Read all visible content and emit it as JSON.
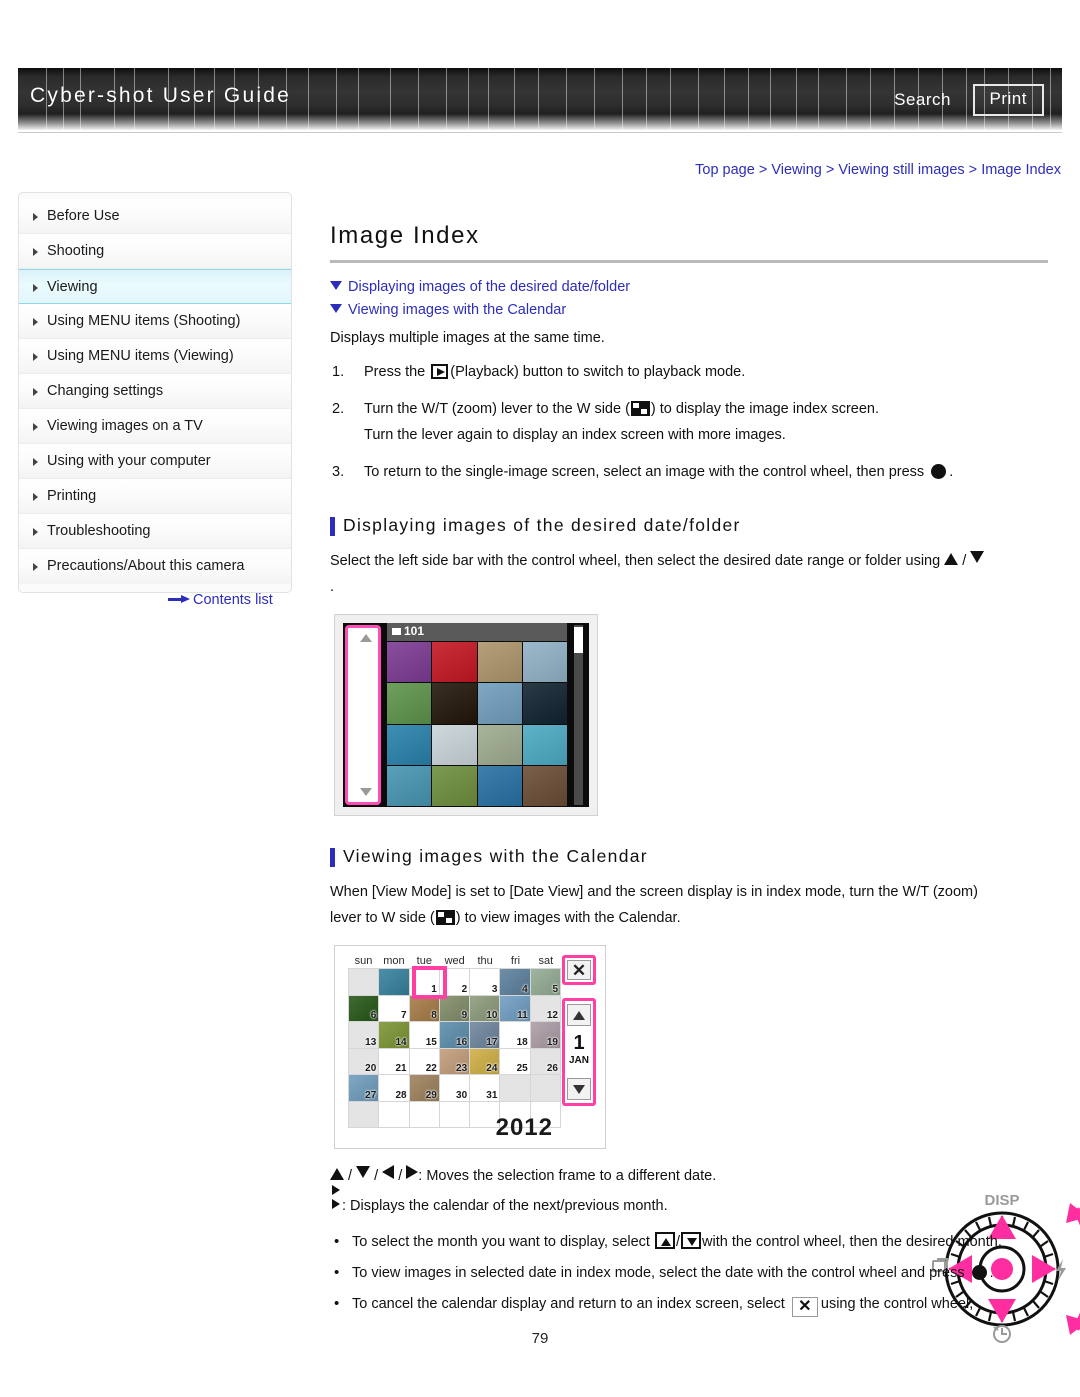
{
  "header": {
    "title": "Cyber-shot User Guide",
    "search_label": "Search",
    "print_label": "Print"
  },
  "breadcrumb": {
    "items": [
      "Top page",
      "Viewing",
      "Viewing still images",
      "Image Index"
    ],
    "separator": ">"
  },
  "sidebar": {
    "items": [
      {
        "label": "Before Use",
        "active": false
      },
      {
        "label": "Shooting",
        "active": false
      },
      {
        "label": "Viewing",
        "active": true
      },
      {
        "label": "Using MENU items (Shooting)",
        "active": false
      },
      {
        "label": "Using MENU items (Viewing)",
        "active": false
      },
      {
        "label": "Changing settings",
        "active": false
      },
      {
        "label": "Viewing images on a TV",
        "active": false
      },
      {
        "label": "Using with your computer",
        "active": false
      },
      {
        "label": "Printing",
        "active": false
      },
      {
        "label": "Troubleshooting",
        "active": false
      },
      {
        "label": "Precautions/About this camera",
        "active": false
      }
    ],
    "contents_link": "Contents list"
  },
  "main": {
    "page_title": "Image Index",
    "anchors": [
      "Displaying images of the desired date/folder",
      "Viewing images with the Calendar"
    ],
    "intro": "Displays multiple images at the same time.",
    "steps": [
      {
        "num": "1.",
        "before_icon": "Press the",
        "icon": "playback-icon",
        "after_icon": "(Playback) button to switch to playback mode."
      },
      {
        "num": "2.",
        "before_icon": "Turn the W/T (zoom) lever to the W side (",
        "icon": "index-icon",
        "after_icon": ") to display the image index screen.",
        "line2": "Turn the lever again to display an index screen with more images."
      },
      {
        "num": "3.",
        "before_icon": "To return to the single-image screen, select an image with the control wheel, then press",
        "icon": "center-button-icon",
        "after_icon": "."
      }
    ],
    "section1": {
      "heading": "Displaying images of the desired date/folder",
      "text_before": "Select the left side bar with the control wheel, then select the desired date range or folder using",
      "text_after": ".",
      "up_icon": "up-triangle-icon",
      "down_icon": "down-triangle-icon",
      "separator": "/"
    },
    "section2": {
      "heading": "Viewing images with the Calendar",
      "line1_before": "When [View Mode] is set to [Date View] and the screen display is in index mode, turn the W/T (zoom)",
      "line2_before": "lever to W side (",
      "line2_icon": "index-icon",
      "line2_after": ") to view images with the Calendar."
    },
    "legend": [
      {
        "icons": [
          "up-triangle-icon",
          "down-triangle-icon",
          "left-triangle-icon",
          "right-triangle-icon"
        ],
        "separator": "/",
        "text": ": Moves the selection frame to a different date."
      },
      {
        "text": ": Displays the calendar of the next/previous month."
      }
    ],
    "bullets": [
      {
        "before": "To select the month you want to display, select",
        "icon_up": "button-up-icon",
        "icon_sep": "/",
        "icon_down": "button-down-icon",
        "after": "with the control wheel, then the desired month."
      },
      {
        "before": "To view images in selected date in index mode, select the date with the control wheel and press",
        "icon": "center-button-icon",
        "after": "."
      },
      {
        "before": "To cancel the calendar display and return to an index screen, select",
        "icon": "close-x-icon",
        "after": "using the control wheel,"
      }
    ]
  },
  "figure_index": {
    "folder_label": "101",
    "thumbnail_colors": [
      "#8a4f9e",
      "#c9303a",
      "#b6a07c",
      "#9db9cc",
      "#6f9f5e",
      "#3a2f24",
      "#7fa8c4",
      "#2a3a46",
      "#3f8fb5",
      "#cfd8dc",
      "#a9b49a",
      "#5fb3c9",
      "#5aa0b8",
      "#7d9a52",
      "#3f7fae",
      "#7a5f4a"
    ]
  },
  "figure_calendar": {
    "weekdays": [
      "sun",
      "mon",
      "tue",
      "wed",
      "thu",
      "fri",
      "sat"
    ],
    "year": "2012",
    "month_number": "1",
    "month_name": "JAN",
    "selected_day": "1",
    "close_label": "✕",
    "days": [
      {
        "n": "",
        "blank": true,
        "color": ""
      },
      {
        "n": "",
        "blank": false,
        "color": "#4d8fa8"
      },
      {
        "n": "1",
        "blank": false,
        "color": ""
      },
      {
        "n": "2",
        "blank": false,
        "color": ""
      },
      {
        "n": "3",
        "blank": false,
        "color": ""
      },
      {
        "n": "4",
        "blank": false,
        "color": "#6f8fa8"
      },
      {
        "n": "5",
        "blank": false,
        "color": "#9fb5a0"
      },
      {
        "n": "6",
        "blank": false,
        "color": "#3f6b33"
      },
      {
        "n": "7",
        "blank": false,
        "color": ""
      },
      {
        "n": "8",
        "blank": false,
        "color": "#b08a5a"
      },
      {
        "n": "9",
        "blank": false,
        "color": "#8f9a7a"
      },
      {
        "n": "10",
        "blank": false,
        "color": "#9aa68a"
      },
      {
        "n": "11",
        "blank": false,
        "color": "#7fa8c9"
      },
      {
        "n": "12",
        "blank": true,
        "color": ""
      },
      {
        "n": "13",
        "blank": true,
        "color": ""
      },
      {
        "n": "14",
        "blank": false,
        "color": "#8aa04a"
      },
      {
        "n": "15",
        "blank": false,
        "color": ""
      },
      {
        "n": "16",
        "blank": false,
        "color": "#6f9ab5"
      },
      {
        "n": "17",
        "blank": false,
        "color": "#7f93a8"
      },
      {
        "n": "18",
        "blank": false,
        "color": ""
      },
      {
        "n": "19",
        "blank": false,
        "color": "#b5a8b0"
      },
      {
        "n": "20",
        "blank": true,
        "color": ""
      },
      {
        "n": "21",
        "blank": false,
        "color": ""
      },
      {
        "n": "22",
        "blank": false,
        "color": ""
      },
      {
        "n": "23",
        "blank": false,
        "color": "#c9a88a"
      },
      {
        "n": "24",
        "blank": false,
        "color": "#d4b85a"
      },
      {
        "n": "25",
        "blank": false,
        "color": ""
      },
      {
        "n": "26",
        "blank": true,
        "color": ""
      },
      {
        "n": "27",
        "blank": false,
        "color": "#7fa8c4"
      },
      {
        "n": "28",
        "blank": false,
        "color": ""
      },
      {
        "n": "29",
        "blank": false,
        "color": "#a8906f"
      },
      {
        "n": "30",
        "blank": false,
        "color": ""
      },
      {
        "n": "31",
        "blank": false,
        "color": ""
      },
      {
        "n": "",
        "blank": true,
        "color": ""
      },
      {
        "n": "",
        "blank": true,
        "color": ""
      },
      {
        "n": "",
        "blank": true,
        "color": ""
      },
      {
        "n": "",
        "blank": false,
        "color": ""
      },
      {
        "n": "",
        "blank": false,
        "color": ""
      },
      {
        "n": "",
        "blank": false,
        "color": ""
      },
      {
        "n": "",
        "blank": false,
        "color": ""
      },
      {
        "n": "",
        "blank": false,
        "color": ""
      },
      {
        "n": "",
        "blank": false,
        "color": ""
      }
    ]
  },
  "figure_wheel": {
    "label_top": "DISP",
    "accent_color": "#ff2ea0"
  },
  "footer": {
    "page_number": "79"
  },
  "colors": {
    "link": "#2d2dbb",
    "accent_pink": "#ff3fa4",
    "sidebar_active": "#d9f3fa",
    "header_bg": "#2b2b2b"
  }
}
